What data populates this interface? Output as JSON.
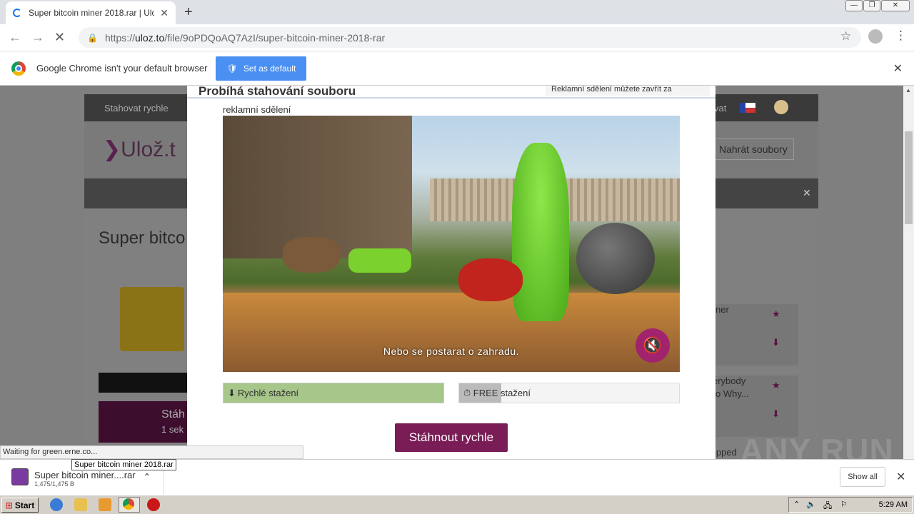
{
  "browser": {
    "tab_title": "Super bitcoin miner 2018.rar | Ulož.t",
    "url_scheme": "https://",
    "url_host": "uloz.to",
    "url_path": "/file/9oPDQoAQ7AzI/super-bitcoin-miner-2018-rar",
    "new_tab": "+",
    "tab_close": "✕"
  },
  "infobar": {
    "text": "Google Chrome isn't your default browser",
    "button": "Set as default",
    "close": "✕"
  },
  "site": {
    "topbar_item": "Stahovat rychle",
    "logo_text": "Ulož.t",
    "upload_button": "Nahrát soubory",
    "page_title": "Super bitco",
    "right_text_1": "ner",
    "right_text_2": "erybody",
    "right_text_3": "o Why...",
    "right_text_4": "ipped",
    "promo_title": "Stáh",
    "promo_sub": "1 sek",
    "partial_right": "vat"
  },
  "modal": {
    "header_left": "Probíhá stahování souboru",
    "header_right": "Reklamní sdělení můžete zavřít za",
    "ad_label": "reklamní sdělení",
    "video_caption": "Nebo se postarat o zahradu.",
    "fast_label": "Rychlé stažení",
    "free_label": "FREE stažení",
    "free_progress": 0.19,
    "download_button": "Stáhnout rychle"
  },
  "status_bubble": "Waiting for green.erne.co...",
  "download_shelf": {
    "tooltip": "Super bitcoin miner 2018.rar",
    "file_name": "Super bitcoin miner....rar",
    "file_size": "1,475/1,475 B",
    "show_all": "Show all"
  },
  "watermark": "ANY RUN",
  "taskbar": {
    "start": "Start",
    "clock": "5:29 AM"
  },
  "colors": {
    "accent_purple": "#7a1c56",
    "mute_button": "#a1236d",
    "fast_bar": "#a7c68a",
    "chrome_blue": "#4a8ff2"
  }
}
